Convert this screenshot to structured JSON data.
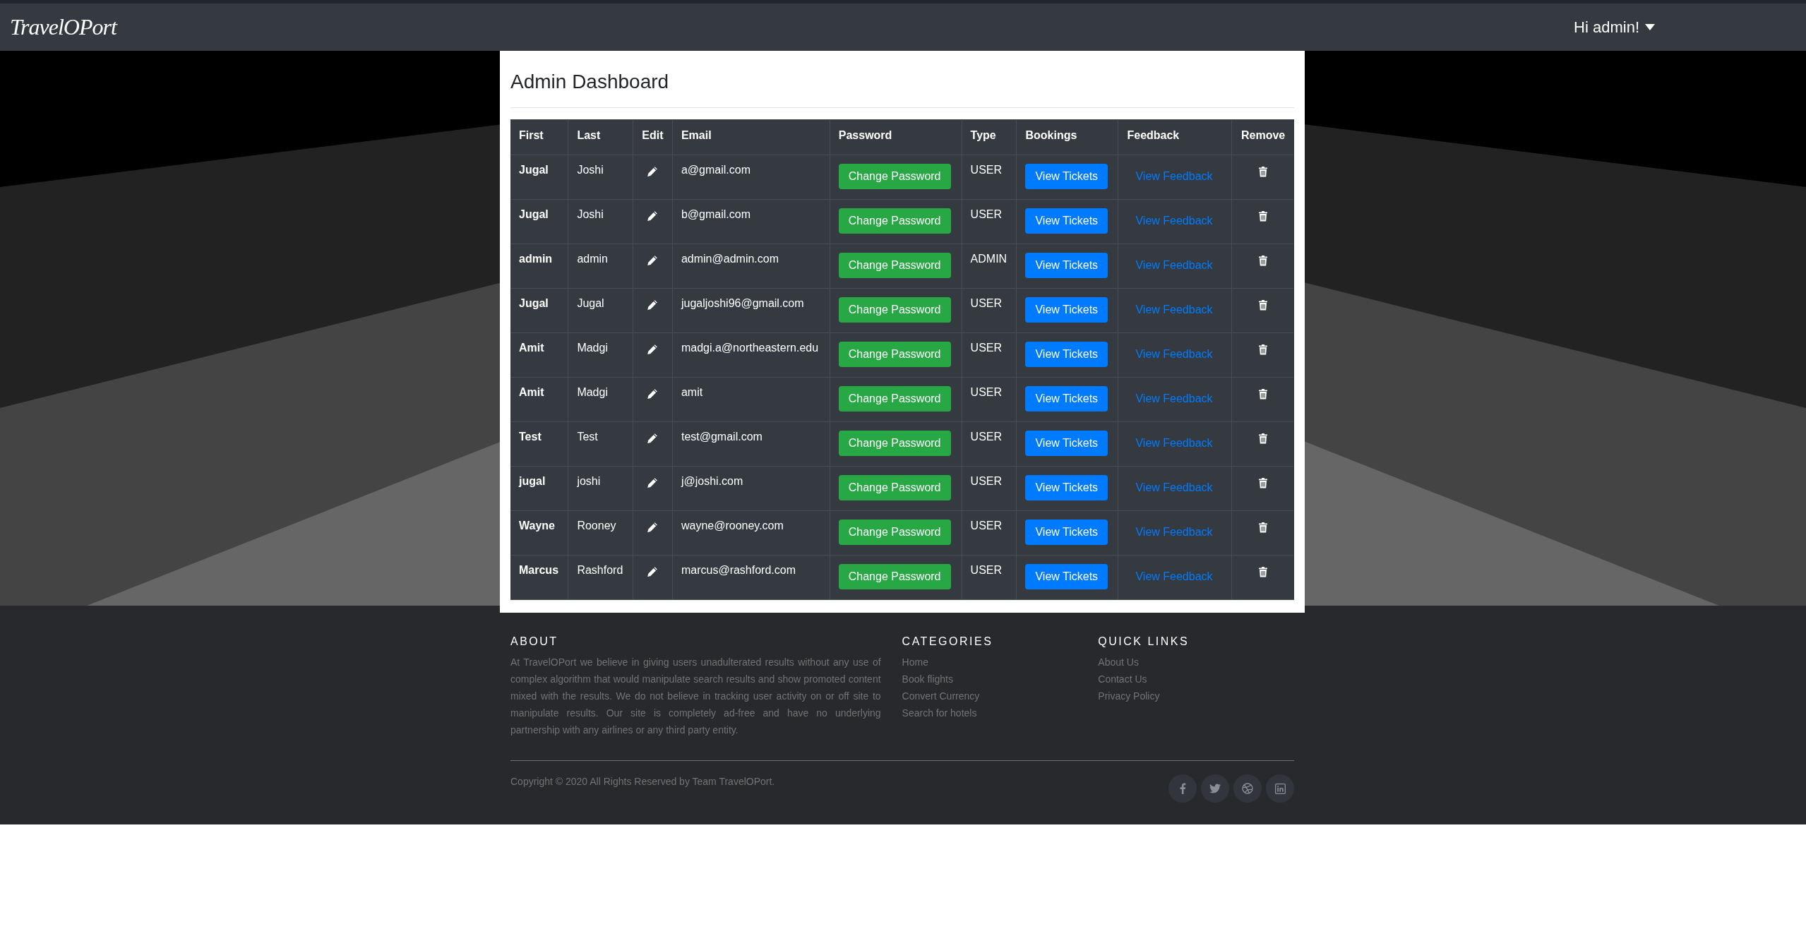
{
  "navbar": {
    "brand": "TravelOPort",
    "user_menu": "Hi admin!"
  },
  "dashboard": {
    "title": "Admin Dashboard",
    "columns": [
      "First",
      "Last",
      "Edit",
      "Email",
      "Password",
      "Type",
      "Bookings",
      "Feedback",
      "Remove"
    ],
    "rows": [
      {
        "first": "Jugal",
        "last": "Joshi",
        "email": "a@gmail.com",
        "password_action": "Change Password",
        "type": "USER",
        "bookings_action": "View Tickets",
        "feedback_action": "View Feedback"
      },
      {
        "first": "Jugal",
        "last": "Joshi",
        "email": "b@gmail.com",
        "password_action": "Change Password",
        "type": "USER",
        "bookings_action": "View Tickets",
        "feedback_action": "View Feedback"
      },
      {
        "first": "admin",
        "last": "admin",
        "email": "admin@admin.com",
        "password_action": "Change Password",
        "type": "ADMIN",
        "bookings_action": "View Tickets",
        "feedback_action": "View Feedback"
      },
      {
        "first": "Jugal",
        "last": "Jugal",
        "email": "jugaljoshi96@gmail.com",
        "password_action": "Change Password",
        "type": "USER",
        "bookings_action": "View Tickets",
        "feedback_action": "View Feedback"
      },
      {
        "first": "Amit",
        "last": "Madgi",
        "email": "madgi.a@northeastern.edu",
        "password_action": "Change Password",
        "type": "USER",
        "bookings_action": "View Tickets",
        "feedback_action": "View Feedback"
      },
      {
        "first": "Amit",
        "last": "Madgi",
        "email": "amit",
        "password_action": "Change Password",
        "type": "USER",
        "bookings_action": "View Tickets",
        "feedback_action": "View Feedback"
      },
      {
        "first": "Test",
        "last": "Test",
        "email": "test@gmail.com",
        "password_action": "Change Password",
        "type": "USER",
        "bookings_action": "View Tickets",
        "feedback_action": "View Feedback"
      },
      {
        "first": "jugal",
        "last": "joshi",
        "email": "j@joshi.com",
        "password_action": "Change Password",
        "type": "USER",
        "bookings_action": "View Tickets",
        "feedback_action": "View Feedback"
      },
      {
        "first": "Wayne",
        "last": "Rooney",
        "email": "wayne@rooney.com",
        "password_action": "Change Password",
        "type": "USER",
        "bookings_action": "View Tickets",
        "feedback_action": "View Feedback"
      },
      {
        "first": "Marcus",
        "last": "Rashford",
        "email": "marcus@rashford.com",
        "password_action": "Change Password",
        "type": "USER",
        "bookings_action": "View Tickets",
        "feedback_action": "View Feedback"
      }
    ]
  },
  "footer": {
    "about": {
      "heading": "ABOUT",
      "text": "At TravelOPort we believe in giving users unadulterated results without any use of complex algorithm that would manipulate search results and show promoted content mixed with the results. We do not believe in tracking user activity on or off site to manipulate results. Our site is completely ad-free and have no underlying partnership with any airlines or any third party entity."
    },
    "link_groups": [
      {
        "heading": "CATEGORIES",
        "links": [
          "Home",
          "Book flights",
          "Convert Currency",
          "Search for hotels"
        ]
      },
      {
        "heading": "QUICK LINKS",
        "links": [
          "About Us",
          "Contact Us",
          "Privacy Policy"
        ]
      }
    ],
    "copyright": "Copyright © 2020 All Rights Reserved by Team TravelOPort.",
    "social": [
      {
        "kind": "facebook"
      },
      {
        "kind": "twitter"
      },
      {
        "kind": "dribbble"
      },
      {
        "kind": "linkedin"
      }
    ]
  }
}
